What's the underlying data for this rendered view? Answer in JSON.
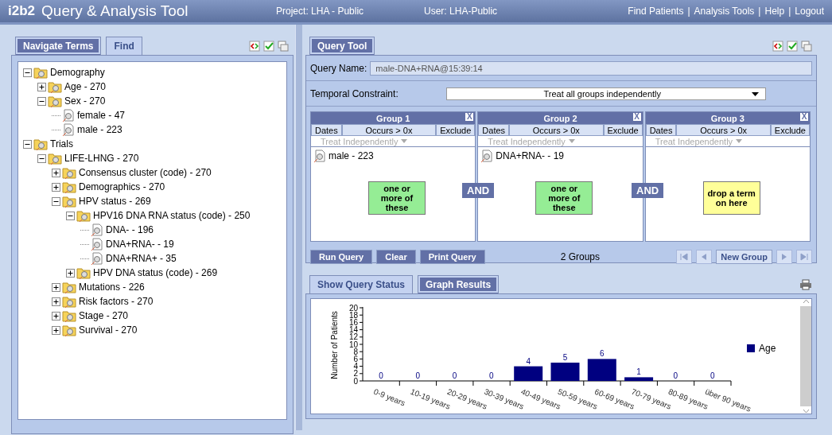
{
  "header": {
    "logo": "i2b2",
    "title": "Query & Analysis Tool",
    "project": "Project: LHA - Public",
    "user": "User: LHA-Public",
    "links": [
      "Find Patients",
      "Analysis Tools",
      "Help",
      "Logout"
    ],
    "link_separator": "|"
  },
  "left_panel": {
    "tabs": [
      {
        "label": "Navigate Terms",
        "selected": true
      },
      {
        "label": "Find",
        "selected": false
      }
    ],
    "tree": [
      {
        "label": "Demography",
        "kind": "folder",
        "expanded": true,
        "children": [
          {
            "label": "Age - 270",
            "kind": "folder",
            "expanded": false
          },
          {
            "label": "Sex - 270",
            "kind": "folder",
            "expanded": true,
            "children": [
              {
                "label": "female - 47",
                "kind": "leaf"
              },
              {
                "label": "male - 223",
                "kind": "leaf"
              }
            ]
          }
        ]
      },
      {
        "label": "Trials",
        "kind": "folder",
        "expanded": true,
        "children": [
          {
            "label": "LIFE-LHNG - 270",
            "kind": "folder",
            "expanded": true,
            "children": [
              {
                "label": "Consensus cluster (code) - 270",
                "kind": "folder",
                "expanded": false
              },
              {
                "label": "Demographics - 270",
                "kind": "folder",
                "expanded": false
              },
              {
                "label": "HPV status - 269",
                "kind": "folder",
                "expanded": true,
                "children": [
                  {
                    "label": "HPV16 DNA RNA status (code) - 250",
                    "kind": "folder",
                    "expanded": true,
                    "children": [
                      {
                        "label": "DNA- - 196",
                        "kind": "leaf"
                      },
                      {
                        "label": "DNA+RNA- - 19",
                        "kind": "leaf"
                      },
                      {
                        "label": "DNA+RNA+ - 35",
                        "kind": "leaf"
                      }
                    ]
                  },
                  {
                    "label": "HPV DNA status (code) - 269",
                    "kind": "folder",
                    "expanded": false
                  }
                ]
              },
              {
                "label": "Mutations - 226",
                "kind": "folder",
                "expanded": false
              },
              {
                "label": "Risk factors - 270",
                "kind": "folder",
                "expanded": false
              },
              {
                "label": "Stage - 270",
                "kind": "folder",
                "expanded": false
              },
              {
                "label": "Survival - 270",
                "kind": "folder",
                "expanded": false
              }
            ]
          }
        ]
      }
    ]
  },
  "query_tool": {
    "tab": {
      "label": "Query Tool",
      "selected": true
    },
    "query_name_label": "Query Name:",
    "query_name": "male-DNA+RNA@15:39:14",
    "temporal_label": "Temporal Constraint:",
    "temporal_value": "Treat all groups independently",
    "groups": [
      {
        "title": "Group 1",
        "close": "X",
        "dates": "Dates",
        "occurs": "Occurs > 0x",
        "exclude": "Exclude",
        "timing": "Treat Independently",
        "terms": [
          "male - 223"
        ],
        "hint": "one or more of these",
        "kind": "filled"
      },
      {
        "title": "Group 2",
        "close": "X",
        "dates": "Dates",
        "occurs": "Occurs > 0x",
        "exclude": "Exclude",
        "timing": "Treat Independently",
        "terms": [
          "DNA+RNA- - 19"
        ],
        "hint": "one or more of these",
        "kind": "filled"
      },
      {
        "title": "Group 3",
        "close": "X",
        "dates": "Dates",
        "occurs": "Occurs > 0x",
        "exclude": "Exclude",
        "timing": "Treat Independently",
        "hint": "drop a term on here",
        "kind": "empty"
      }
    ],
    "connectors": [
      "AND",
      "AND"
    ],
    "buttons": [
      "Run Query",
      "Clear",
      "Print Query"
    ],
    "group_count": "2 Groups",
    "new_group": "New Group"
  },
  "results": {
    "tabs": [
      {
        "label": "Show Query Status",
        "selected": false
      },
      {
        "label": "Graph Results",
        "selected": true
      }
    ],
    "chart_data": {
      "type": "bar",
      "ylabel": "Number of Patients",
      "categories": [
        "0-9 years",
        "10-19 years",
        "20-29 years",
        "30-39 years",
        "40-49 years",
        "50-59 years",
        "60-69 years",
        "70-79 years",
        "80-89 years",
        "über 90 years"
      ],
      "series": [
        {
          "name": "Age",
          "color": "#000080",
          "values": [
            0,
            0,
            0,
            0,
            4,
            5,
            6,
            1,
            0,
            0
          ]
        }
      ],
      "ylim": [
        0,
        20
      ],
      "yticks": [
        0,
        2,
        4,
        6,
        8,
        10,
        12,
        14,
        16,
        18,
        20
      ],
      "data_labels": true
    }
  }
}
